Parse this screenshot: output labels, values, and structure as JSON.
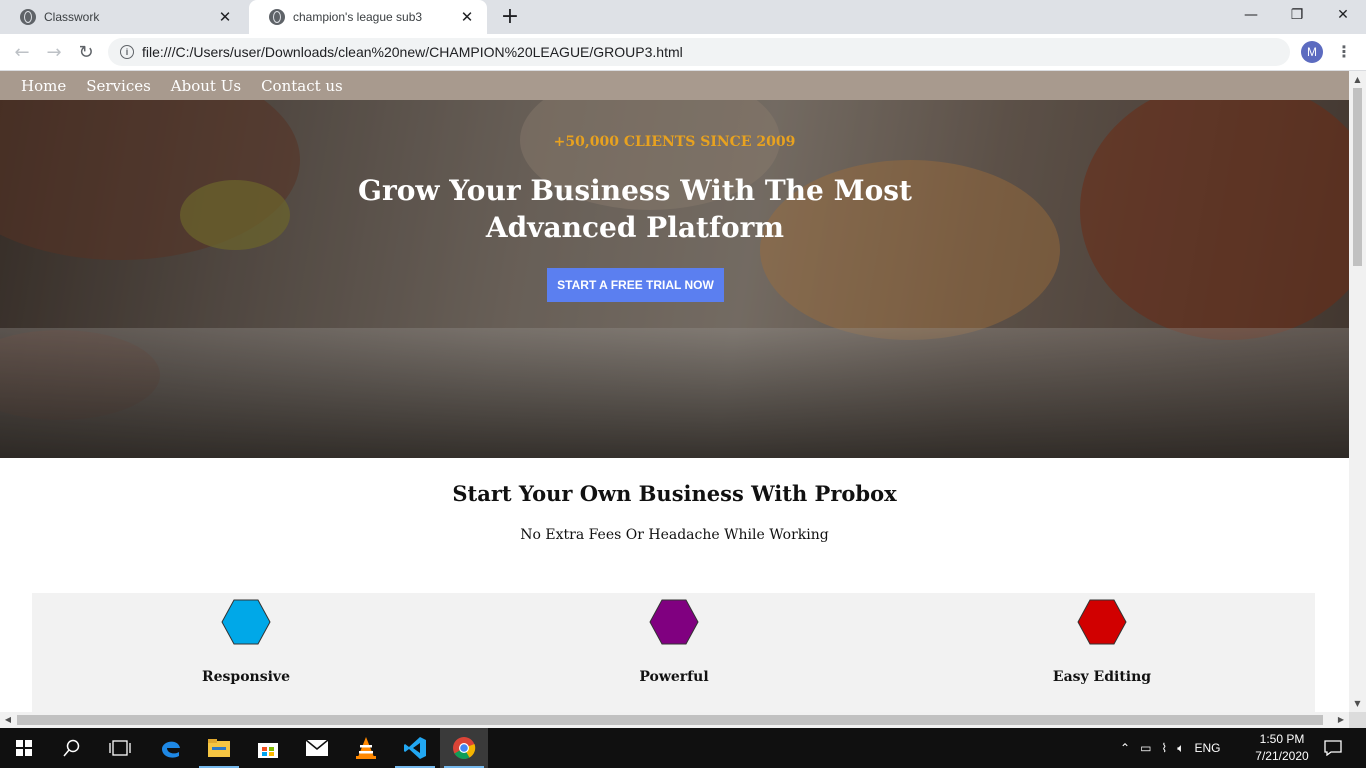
{
  "browser": {
    "tabs": [
      {
        "title": "Classwork",
        "close": "✕"
      },
      {
        "title": "champion's league sub3",
        "close": "✕"
      }
    ],
    "new_tab": "+",
    "window_controls": {
      "minimize": "—",
      "restore": "❐",
      "close": "✕"
    },
    "nav": {
      "back": "←",
      "forward": "→",
      "reload": "↻"
    },
    "address": "file:///C:/Users/user/Downloads/clean%20new/CHAMPION%20LEAGUE/GROUP3.html",
    "info_icon": "i",
    "profile_initial": "M",
    "menu": "⋮"
  },
  "site": {
    "nav": [
      "Home",
      "Services",
      "About Us",
      "Contact us"
    ],
    "hero": {
      "tagline": "+50,000 CLIENTS SINCE 2009",
      "title": "Grow Your Business With The Most Advanced Platform",
      "cta": "START A FREE TRIAL NOW"
    },
    "section": {
      "title": "Start Your Own Business With Probox",
      "subtitle": "No Extra Fees Or Headache While Working"
    },
    "features": [
      {
        "label": "Responsive",
        "color": "#00a8e8"
      },
      {
        "label": "Powerful",
        "color": "#800080"
      },
      {
        "label": "Easy Editing",
        "color": "#d10000"
      }
    ]
  },
  "colors": {
    "nav_bar": "#a89a8e",
    "tagline": "#e8a21f",
    "cta": "#5b7ff0",
    "feature_bg": "#f2f2f2"
  },
  "taskbar": {
    "icons": [
      "windows-start-icon",
      "search-icon",
      "task-view-icon",
      "edge-icon",
      "file-explorer-icon",
      "store-icon",
      "mail-icon",
      "vlc-icon",
      "vscode-icon",
      "chrome-icon"
    ],
    "language": "ENG",
    "time": "1:50 PM",
    "date": "7/21/2020"
  }
}
